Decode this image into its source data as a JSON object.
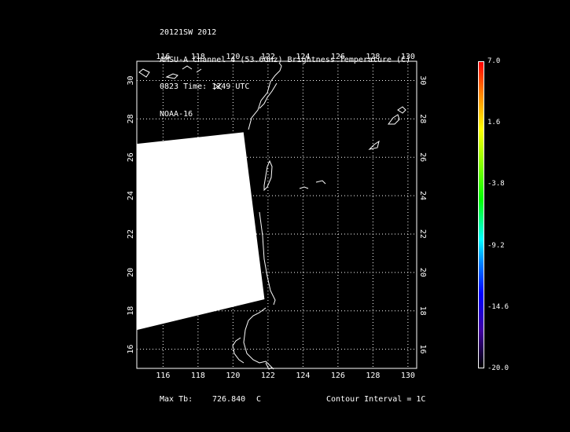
{
  "header": {
    "line1": "20121SW 2012",
    "line2": "AMSU-A Channel 4 (53.6GHz) Brightness Temperature (C)",
    "line3": "0823 Time: 1249 UTC",
    "line4": "NOAA-16"
  },
  "map": {
    "lon_range": [
      114.5,
      130.5
    ],
    "lat_range": [
      15,
      31
    ],
    "lon_ticks": [
      "116",
      "118",
      "120",
      "122",
      "124",
      "126",
      "128",
      "130"
    ],
    "lat_ticks": [
      "16",
      "18",
      "20",
      "22",
      "24",
      "26",
      "28",
      "30"
    ],
    "grid": "dotted",
    "swath_color": "#ffffff",
    "coast_color": "#ffffff"
  },
  "colorbar": {
    "labels": [
      "7.0",
      "1.6",
      "-3.8",
      "-9.2",
      "-14.6",
      "-20.0"
    ],
    "colors": [
      "#ff0000",
      "#ffff00",
      "#00ff00",
      "#00ffff",
      "#0000ff",
      "#000000"
    ]
  },
  "footer": {
    "max_tb_label": "Max Tb:",
    "max_tb_value": "726.840",
    "max_tb_unit": "C",
    "contour": "Contour Interval = 1C"
  }
}
